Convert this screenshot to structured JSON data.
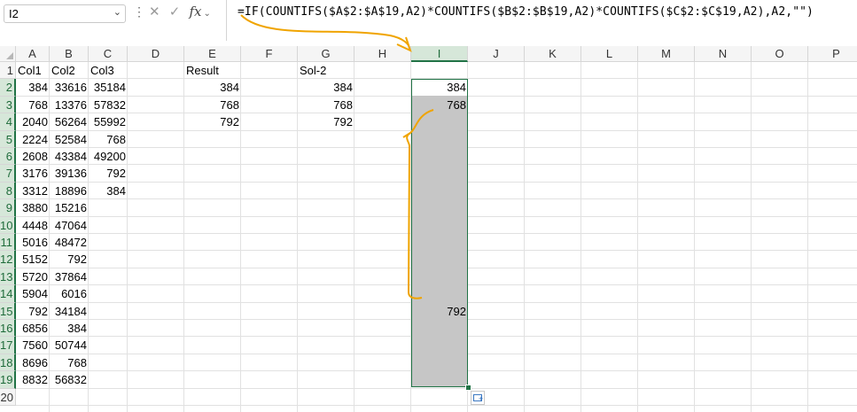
{
  "formula_bar": {
    "name_box": "I2",
    "formula": "=IF(COUNTIFS($A$2:$A$19,A2)*COUNTIFS($B$2:$B$19,A2)*COUNTIFS($C$2:$C$19,A2),A2,\"\")",
    "icons": [
      "chevron-down-icon",
      "more-vert-icon",
      "cancel-x-icon",
      "confirm-check-icon",
      "fx-icon"
    ]
  },
  "columns": [
    "A",
    "B",
    "C",
    "D",
    "E",
    "F",
    "G",
    "H",
    "I",
    "J",
    "K",
    "L",
    "M",
    "N",
    "O",
    "P"
  ],
  "selected_column": "I",
  "rows": [
    "1",
    "2",
    "3",
    "4",
    "5",
    "6",
    "7",
    "8",
    "9",
    "10",
    "11",
    "12",
    "13",
    "14",
    "15",
    "16",
    "17",
    "18",
    "19",
    "20"
  ],
  "headers": {
    "col1": "Col1",
    "col2": "Col2",
    "col3": "Col3",
    "result": "Result",
    "sol2": "Sol-2"
  },
  "colA": [
    "384",
    "768",
    "2040",
    "2224",
    "2608",
    "3176",
    "3312",
    "3880",
    "4448",
    "5016",
    "5152",
    "5720",
    "5904",
    "792",
    "6856",
    "7560",
    "8696",
    "8832"
  ],
  "colB": [
    "33616",
    "13376",
    "56264",
    "52584",
    "43384",
    "39136",
    "18896",
    "15216",
    "47064",
    "48472",
    "792",
    "37864",
    "6016",
    "34184",
    "384",
    "50744",
    "768",
    "56832"
  ],
  "colC": [
    "35184",
    "57832",
    "55992",
    "768",
    "49200",
    "792",
    "384"
  ],
  "colE": [
    "384",
    "768",
    "792"
  ],
  "colG": [
    "384",
    "768",
    "792"
  ],
  "colI": {
    "row2": "384",
    "row3": "768",
    "row15": "792"
  },
  "colors": {
    "accent": "#217346",
    "selection_fill": "#c6c6c6",
    "annotation": "#f0a400"
  }
}
